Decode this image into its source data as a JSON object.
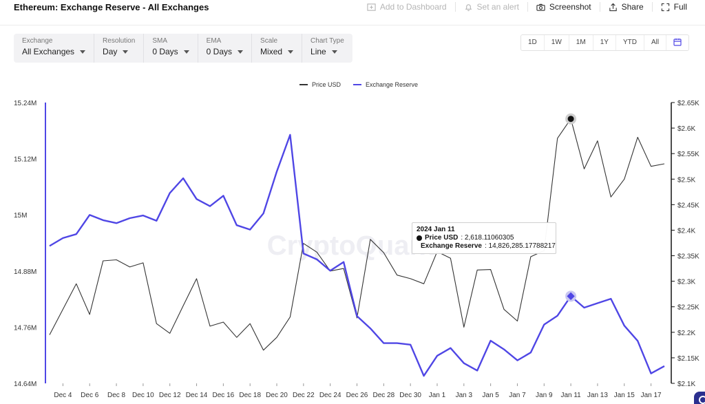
{
  "page": {
    "title": "Ethereum: Exchange Reserve - All Exchanges"
  },
  "toolbar": {
    "add_to_dashboard": "Add to Dashboard",
    "set_alert": "Set an alert",
    "screenshot": "Screenshot",
    "share": "Share",
    "full": "Full"
  },
  "filters": [
    {
      "label": "Exchange",
      "value": "All Exchanges"
    },
    {
      "label": "Resolution",
      "value": "Day"
    },
    {
      "label": "SMA",
      "value": "0 Days"
    },
    {
      "label": "EMA",
      "value": "0 Days"
    },
    {
      "label": "Scale",
      "value": "Mixed"
    },
    {
      "label": "Chart Type",
      "value": "Line"
    }
  ],
  "ranges": [
    "1D",
    "1W",
    "1M",
    "1Y",
    "YTD",
    "All"
  ],
  "colors": {
    "price": "#333333",
    "reserve": "#4f46e5",
    "axis_left": "#4f46e5",
    "axis_right": "#111111"
  },
  "watermark": "CryptoQuant",
  "tooltip": {
    "date": "2024 Jan 11",
    "price_key": "Price USD",
    "price_val": ": 2,618.11060305",
    "reserve_key": "Exchange Reserve",
    "reserve_val": ": 14,826,285.17788217"
  },
  "chart_data": {
    "type": "line",
    "legend": [
      "Price USD",
      "Exchange Reserve"
    ],
    "legend_position": "top-center",
    "x": [
      "2023-12-03",
      "2023-12-04",
      "2023-12-05",
      "2023-12-06",
      "2023-12-07",
      "2023-12-08",
      "2023-12-09",
      "2023-12-10",
      "2023-12-11",
      "2023-12-12",
      "2023-12-13",
      "2023-12-14",
      "2023-12-15",
      "2023-12-16",
      "2023-12-17",
      "2023-12-18",
      "2023-12-19",
      "2023-12-20",
      "2023-12-21",
      "2023-12-22",
      "2023-12-23",
      "2023-12-24",
      "2023-12-25",
      "2023-12-26",
      "2023-12-27",
      "2023-12-28",
      "2023-12-29",
      "2023-12-30",
      "2023-12-31",
      "2024-01-01",
      "2024-01-02",
      "2024-01-03",
      "2024-01-04",
      "2024-01-05",
      "2024-01-06",
      "2024-01-07",
      "2024-01-08",
      "2024-01-09",
      "2024-01-10",
      "2024-01-11",
      "2024-01-12",
      "2024-01-13",
      "2024-01-14",
      "2024-01-15",
      "2024-01-16",
      "2024-01-17",
      "2024-01-18"
    ],
    "x_ticks": [
      "Dec 4",
      "Dec 6",
      "Dec 8",
      "Dec 10",
      "Dec 12",
      "Dec 14",
      "Dec 16",
      "Dec 18",
      "Dec 20",
      "Dec 22",
      "Dec 24",
      "Dec 26",
      "Dec 28",
      "Dec 30",
      "Jan 1",
      "Jan 3",
      "Jan 5",
      "Jan 7",
      "Jan 9",
      "Jan 11",
      "Jan 13",
      "Jan 15",
      "Jan 17"
    ],
    "series": [
      {
        "name": "Price USD",
        "axis": "right",
        "values": [
          2195,
          2245,
          2295,
          2235,
          2340,
          2342,
          2328,
          2336,
          2217,
          2198,
          2252,
          2305,
          2212,
          2220,
          2190,
          2217,
          2165,
          2190,
          2230,
          2374,
          2357,
          2320,
          2325,
          2228,
          2382,
          2356,
          2312,
          2305,
          2295,
          2358,
          2345,
          2210,
          2322,
          2323,
          2245,
          2222,
          2348,
          2360,
          2580,
          2618,
          2520,
          2575,
          2465,
          2500,
          2582,
          2525,
          2530
        ]
      },
      {
        "name": "Exchange Reserve",
        "axis": "left",
        "values": [
          14.9335,
          14.9505,
          14.9588,
          14.9999,
          14.9887,
          14.9824,
          14.9929,
          14.9987,
          14.9873,
          15.0468,
          15.0782,
          15.0338,
          15.0186,
          15.0409,
          14.9779,
          14.9686,
          15.0031,
          15.0925,
          15.1711,
          14.9174,
          14.9049,
          14.8807,
          14.8992,
          14.7838,
          14.7575,
          14.7259,
          14.7259,
          14.7227,
          14.6561,
          14.6989,
          14.7154,
          14.6831,
          14.6673,
          14.7312,
          14.7127,
          14.6891,
          14.7059,
          14.7656,
          14.7846,
          14.8263,
          14.8017,
          14.8113,
          14.8207,
          14.7633,
          14.7307,
          14.6612,
          14.6769
        ]
      }
    ],
    "left_axis": {
      "min": 14.64,
      "max": 15.24,
      "ticks": [
        "14.64M",
        "14.76M",
        "14.88M",
        "15M",
        "15.12M",
        "15.24M"
      ]
    },
    "right_axis": {
      "min": 2100,
      "max": 2650,
      "ticks": [
        "$2.1K",
        "$2.15K",
        "$2.2K",
        "$2.25K",
        "$2.3K",
        "$2.35K",
        "$2.4K",
        "$2.45K",
        "$2.5K",
        "$2.55K",
        "$2.6K",
        "$2.65K"
      ]
    },
    "highlight_index": 39,
    "grid": false
  }
}
